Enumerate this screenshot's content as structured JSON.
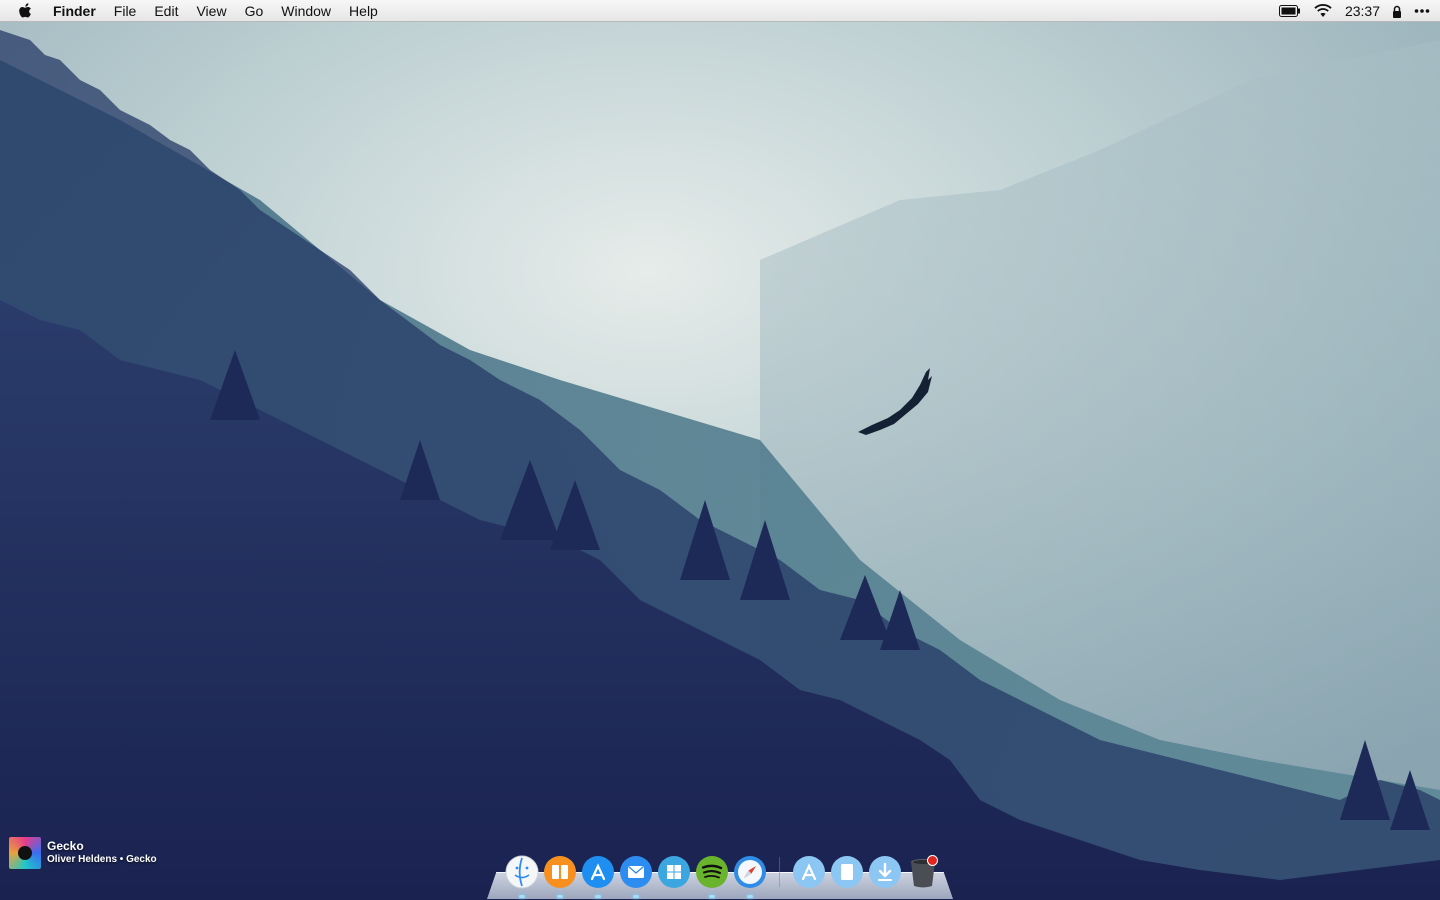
{
  "menubar": {
    "apple_icon": "apple-logo-icon",
    "app_name": "Finder",
    "menus": [
      "File",
      "Edit",
      "View",
      "Go",
      "Window",
      "Help"
    ],
    "status": {
      "battery_icon": "battery-icon",
      "wifi_icon": "wifi-icon",
      "clock": "23:37",
      "lock_icon": "lock-icon",
      "more_icon": "more-dots-icon"
    }
  },
  "now_playing": {
    "title": "Gecko",
    "subtitle": "Oliver Heldens • Gecko"
  },
  "dock": {
    "apps": [
      {
        "icon": "finder-icon",
        "running": true
      },
      {
        "icon": "ibooks-icon",
        "running": true
      },
      {
        "icon": "app-store-icon",
        "running": true
      },
      {
        "icon": "mail-icon",
        "running": true
      },
      {
        "icon": "windows-icon",
        "running": false
      },
      {
        "icon": "spotify-icon",
        "running": true
      },
      {
        "icon": "safari-icon",
        "running": true
      }
    ],
    "stacks": [
      {
        "icon": "applications-folder-icon"
      },
      {
        "icon": "documents-folder-icon"
      },
      {
        "icon": "downloads-folder-icon"
      },
      {
        "icon": "trash-icon"
      }
    ]
  },
  "colors": {
    "sky_light": "#dde6e6",
    "forest_dark": "#1c2550",
    "accent": "#2d8cf0"
  }
}
